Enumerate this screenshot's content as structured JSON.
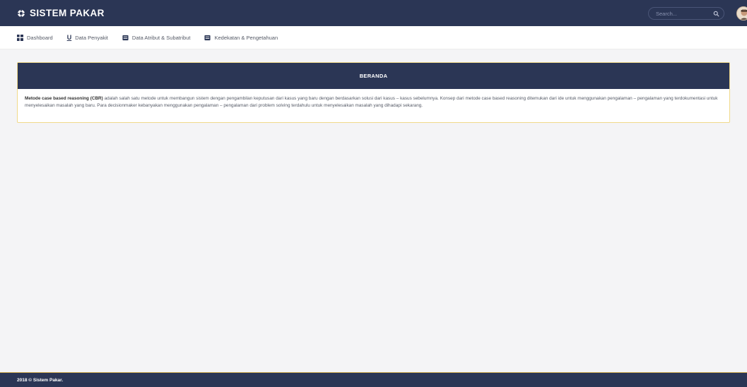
{
  "topbar": {
    "brand": "SISTEM PAKAR",
    "brand_icon": "gear-cog-icon",
    "search_placeholder": "Search...",
    "search_icon": "search-icon",
    "avatar": "user-avatar"
  },
  "menu": {
    "items": [
      {
        "label": "Dashboard",
        "icon": "dashboard-icon"
      },
      {
        "label": "Data Penyakit",
        "icon": "u-icon",
        "glyph": "U"
      },
      {
        "label": "Data Atribut & Subatribut",
        "icon": "database-icon"
      },
      {
        "label": "Kedekatan & Pengetahuan",
        "icon": "database-icon"
      }
    ]
  },
  "card": {
    "title": "BERANDA",
    "bold_lead": "Metode case based reasoning (CBR)",
    "body_rest": " adalah salah satu metode untuk membangun sistem dengan pengambilan keputusan dari kasus yang baru dengan berdasarkan solusi dari kasus – kasus sebelumnya. Konsep dari metode case based reasoning ditemukan dari ide untuk menggunakan pengalaman – pengalaman yang terdokumentasi untuk menyelesaikan masalah yang baru. Para decisionmaker kebanyakan menggunakan pengalaman – pengalaman dari problem solving terdahulu untuk menyelesaikan masalah yang dihadapi sekarang."
  },
  "footer": {
    "text": "2018 © Sistem Pakar."
  },
  "colors": {
    "navy": "#2b3655",
    "card_border": "#f0d98a",
    "background": "#f4f4f6"
  }
}
